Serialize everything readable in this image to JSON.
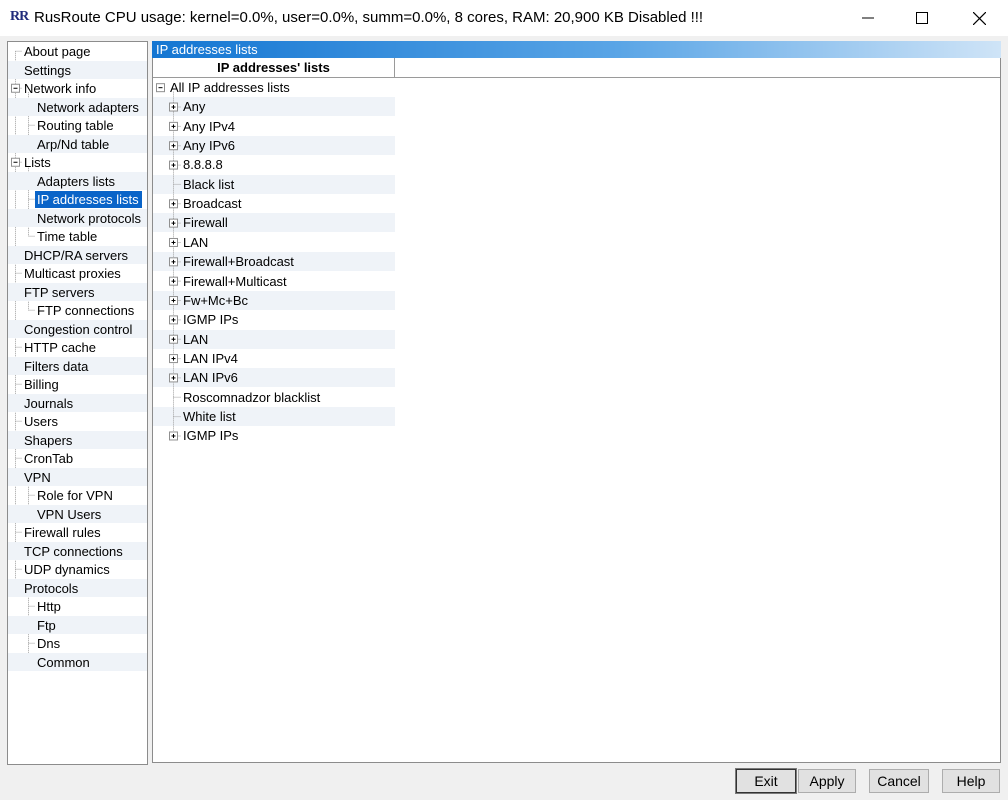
{
  "window": {
    "logo_text": "RR",
    "title": "RusRoute   CPU usage: kernel=0.0%, user=0.0%, summ=0.0%, 8 cores,  RAM: 20,900 KB Disabled !!!"
  },
  "sidebar": {
    "items": [
      {
        "label": "About page",
        "level": 0
      },
      {
        "label": "Settings",
        "level": 0
      },
      {
        "label": "Network info",
        "level": 0,
        "expandable": true
      },
      {
        "label": "Network adapters",
        "level": 1
      },
      {
        "label": "Routing table",
        "level": 1
      },
      {
        "label": "Arp/Nd table",
        "level": 1
      },
      {
        "label": "Lists",
        "level": 0,
        "expandable": true
      },
      {
        "label": "Adapters lists",
        "level": 1
      },
      {
        "label": "IP addresses lists",
        "level": 1,
        "selected": true
      },
      {
        "label": "Network protocols",
        "level": 1
      },
      {
        "label": "Time table",
        "level": 1
      },
      {
        "label": "DHCP/RA servers",
        "level": 0
      },
      {
        "label": "Multicast proxies",
        "level": 0
      },
      {
        "label": "FTP servers",
        "level": 0,
        "expandable": true
      },
      {
        "label": "FTP connections",
        "level": 1
      },
      {
        "label": "Congestion control",
        "level": 0
      },
      {
        "label": "HTTP cache",
        "level": 0
      },
      {
        "label": "Filters data",
        "level": 0
      },
      {
        "label": "Billing",
        "level": 0
      },
      {
        "label": "Journals",
        "level": 0
      },
      {
        "label": "Users",
        "level": 0
      },
      {
        "label": "Shapers",
        "level": 0
      },
      {
        "label": "CronTab",
        "level": 0
      },
      {
        "label": "VPN",
        "level": 0,
        "expandable": true
      },
      {
        "label": "Role for VPN",
        "level": 1
      },
      {
        "label": "VPN Users",
        "level": 1
      },
      {
        "label": "Firewall rules",
        "level": 0
      },
      {
        "label": "TCP connections",
        "level": 0
      },
      {
        "label": "UDP dynamics",
        "level": 0
      },
      {
        "label": "Protocols",
        "level": 0,
        "expandable": true
      },
      {
        "label": "Http",
        "level": 1
      },
      {
        "label": "Ftp",
        "level": 1
      },
      {
        "label": "Dns",
        "level": 1
      },
      {
        "label": "Common",
        "level": 1
      }
    ]
  },
  "main": {
    "header_title": "IP addresses lists",
    "column_header": "IP addresses' lists",
    "root_label": "All IP addresses lists",
    "items": [
      {
        "label": "Any",
        "expandable": true
      },
      {
        "label": "Any IPv4",
        "expandable": true
      },
      {
        "label": "Any IPv6",
        "expandable": true
      },
      {
        "label": "8.8.8.8",
        "expandable": true
      },
      {
        "label": "Black list",
        "expandable": false
      },
      {
        "label": "Broadcast",
        "expandable": true
      },
      {
        "label": "Firewall",
        "expandable": true
      },
      {
        "label": "LAN",
        "expandable": true
      },
      {
        "label": "Firewall+Broadcast",
        "expandable": true
      },
      {
        "label": "Firewall+Multicast",
        "expandable": true
      },
      {
        "label": "Fw+Mc+Bc",
        "expandable": true
      },
      {
        "label": "IGMP IPs",
        "expandable": true
      },
      {
        "label": "LAN",
        "expandable": true
      },
      {
        "label": "LAN IPv4",
        "expandable": true
      },
      {
        "label": "LAN IPv6",
        "expandable": true
      },
      {
        "label": "Roscomnadzor blacklist",
        "expandable": false
      },
      {
        "label": "White list",
        "expandable": false
      },
      {
        "label": "IGMP IPs",
        "expandable": true
      }
    ]
  },
  "buttons": {
    "exit": "Exit",
    "apply": "Apply",
    "cancel": "Cancel",
    "help": "Help"
  },
  "colors": {
    "selection": "#0a64c8",
    "header_gradient_start": "#1476d2",
    "stripe": "#eff3f8"
  }
}
